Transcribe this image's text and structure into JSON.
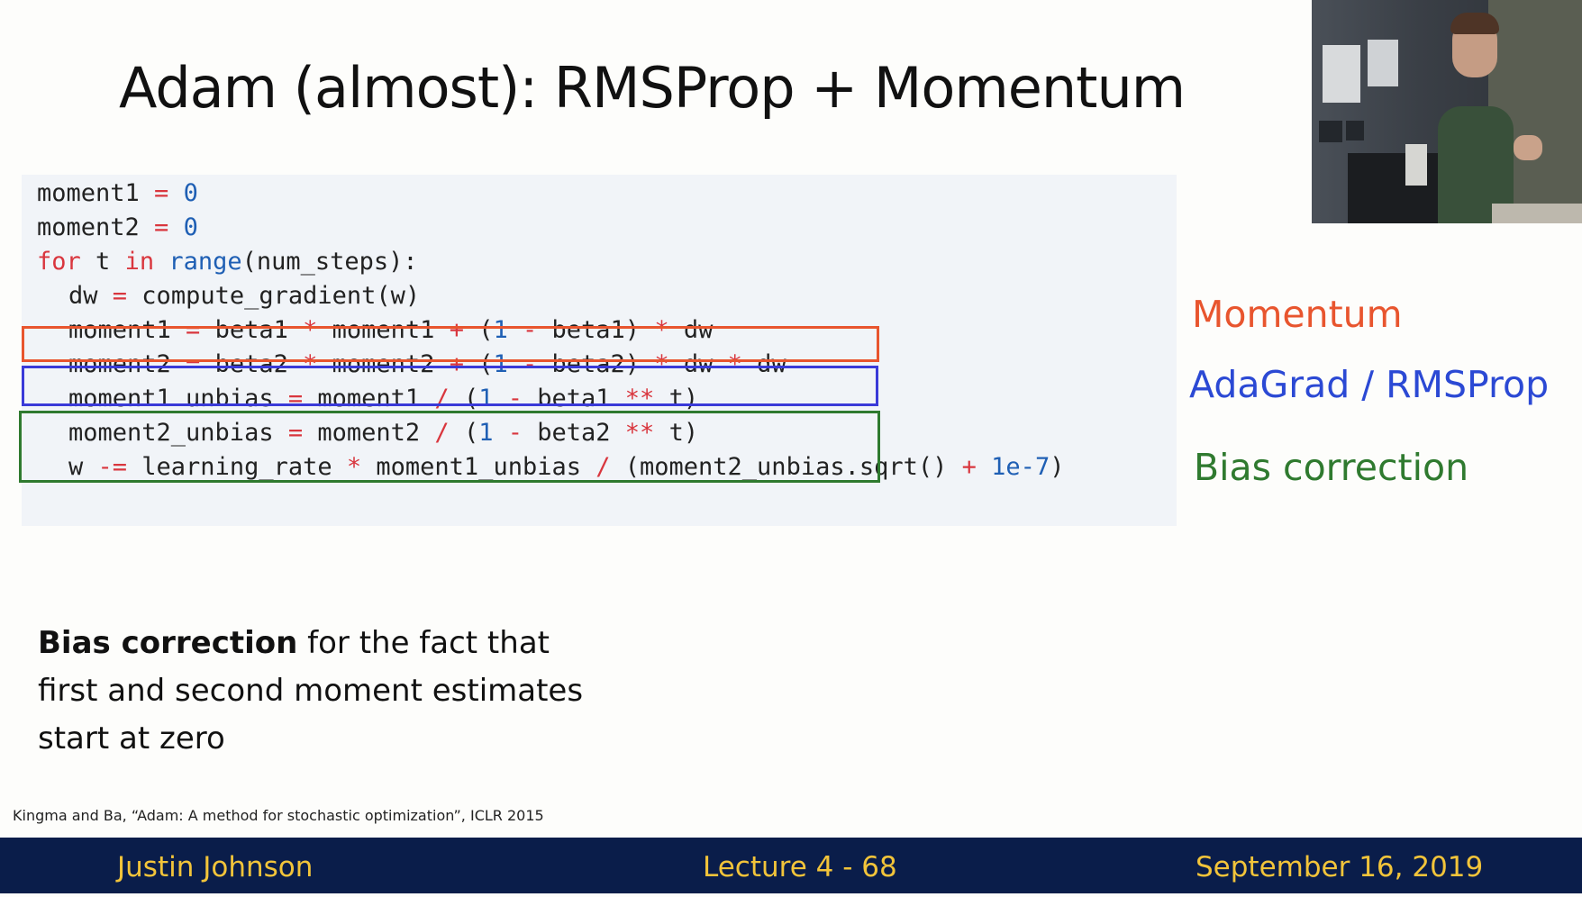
{
  "slide": {
    "title_bold": "Adam",
    "title_rest": " (almost): RMSProp + Momentum"
  },
  "code": {
    "lines": [
      [
        {
          "t": "moment1 ",
          "c": ""
        },
        {
          "t": "=",
          "c": "op"
        },
        {
          "t": " ",
          "c": ""
        },
        {
          "t": "0",
          "c": "num"
        }
      ],
      [
        {
          "t": "moment2 ",
          "c": ""
        },
        {
          "t": "=",
          "c": "op"
        },
        {
          "t": " ",
          "c": ""
        },
        {
          "t": "0",
          "c": "num"
        }
      ],
      [
        {
          "t": "for",
          "c": "kw"
        },
        {
          "t": " t ",
          "c": ""
        },
        {
          "t": "in",
          "c": "kw"
        },
        {
          "t": " ",
          "c": ""
        },
        {
          "t": "range",
          "c": "fn"
        },
        {
          "t": "(num_steps):",
          "c": ""
        }
      ],
      [
        {
          "t": "dw ",
          "c": ""
        },
        {
          "t": "=",
          "c": "op"
        },
        {
          "t": " compute_gradient(w)",
          "c": ""
        }
      ],
      [
        {
          "t": "moment1 ",
          "c": ""
        },
        {
          "t": "=",
          "c": "op"
        },
        {
          "t": " beta1 ",
          "c": ""
        },
        {
          "t": "*",
          "c": "op"
        },
        {
          "t": " moment1 ",
          "c": ""
        },
        {
          "t": "+",
          "c": "op"
        },
        {
          "t": " (",
          "c": ""
        },
        {
          "t": "1",
          "c": "num"
        },
        {
          "t": " ",
          "c": ""
        },
        {
          "t": "-",
          "c": "op"
        },
        {
          "t": " beta1) ",
          "c": ""
        },
        {
          "t": "*",
          "c": "op"
        },
        {
          "t": " dw",
          "c": ""
        }
      ],
      [
        {
          "t": "moment2 ",
          "c": ""
        },
        {
          "t": "=",
          "c": "op"
        },
        {
          "t": " beta2 ",
          "c": ""
        },
        {
          "t": "*",
          "c": "op"
        },
        {
          "t": " moment2 ",
          "c": ""
        },
        {
          "t": "+",
          "c": "op"
        },
        {
          "t": " (",
          "c": ""
        },
        {
          "t": "1",
          "c": "num"
        },
        {
          "t": " ",
          "c": ""
        },
        {
          "t": "-",
          "c": "op"
        },
        {
          "t": " beta2) ",
          "c": ""
        },
        {
          "t": "*",
          "c": "op"
        },
        {
          "t": " dw ",
          "c": ""
        },
        {
          "t": "*",
          "c": "op"
        },
        {
          "t": " dw",
          "c": ""
        }
      ],
      [
        {
          "t": "moment1_unbias ",
          "c": ""
        },
        {
          "t": "=",
          "c": "op"
        },
        {
          "t": " moment1 ",
          "c": ""
        },
        {
          "t": "/",
          "c": "op"
        },
        {
          "t": " (",
          "c": ""
        },
        {
          "t": "1",
          "c": "num"
        },
        {
          "t": " ",
          "c": ""
        },
        {
          "t": "-",
          "c": "op"
        },
        {
          "t": " beta1 ",
          "c": ""
        },
        {
          "t": "**",
          "c": "op"
        },
        {
          "t": " t)",
          "c": ""
        }
      ],
      [
        {
          "t": "moment2_unbias ",
          "c": ""
        },
        {
          "t": "=",
          "c": "op"
        },
        {
          "t": " moment2 ",
          "c": ""
        },
        {
          "t": "/",
          "c": "op"
        },
        {
          "t": " (",
          "c": ""
        },
        {
          "t": "1",
          "c": "num"
        },
        {
          "t": " ",
          "c": ""
        },
        {
          "t": "-",
          "c": "op"
        },
        {
          "t": " beta2 ",
          "c": ""
        },
        {
          "t": "**",
          "c": "op"
        },
        {
          "t": " t)",
          "c": ""
        }
      ],
      [
        {
          "t": "w ",
          "c": ""
        },
        {
          "t": "-=",
          "c": "op"
        },
        {
          "t": " learning_rate ",
          "c": ""
        },
        {
          "t": "*",
          "c": "op"
        },
        {
          "t": " moment1_unbias ",
          "c": ""
        },
        {
          "t": "/",
          "c": "op"
        },
        {
          "t": " (moment2_unbias.sqrt() ",
          "c": ""
        },
        {
          "t": "+",
          "c": "op"
        },
        {
          "t": " ",
          "c": ""
        },
        {
          "t": "1e-7",
          "c": "num"
        },
        {
          "t": ")",
          "c": ""
        }
      ]
    ]
  },
  "tags": {
    "momentum": "Momentum",
    "adagrad": "AdaGrad / RMSProp",
    "bias": "Bias correction"
  },
  "note": {
    "bold": "Bias correction",
    "rest": " for the fact that first and second moment estimates start at zero"
  },
  "citation": "Kingma and Ba, “Adam: A method for stochastic optimization”, ICLR 2015",
  "footer": {
    "author": "Justin Johnson",
    "lecture": "Lecture 4 - 68",
    "date": "September 16, 2019"
  },
  "colors": {
    "momentum": "#e8552e",
    "adagrad": "#2b49d4",
    "bias": "#2f7a2f",
    "footer_bg": "#0a1d4a",
    "footer_text": "#f2c43a"
  }
}
